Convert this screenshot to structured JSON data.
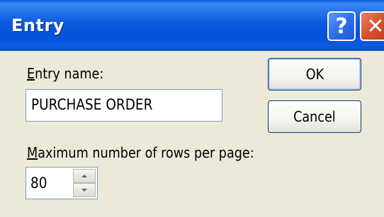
{
  "window": {
    "title": "Entry",
    "help_glyph": "?",
    "close_glyph": "✕"
  },
  "form": {
    "entry_name_label_accel": "E",
    "entry_name_label_rest": "ntry name:",
    "entry_name_value": "PURCHASE ORDER",
    "max_rows_label_accel": "M",
    "max_rows_label_rest": "aximum number of rows per page:",
    "max_rows_value": "80"
  },
  "buttons": {
    "ok_label": "OK",
    "cancel_label": "Cancel"
  },
  "icons": {
    "help": "help-icon",
    "close": "close-icon",
    "spin_up": "chevron-up-icon",
    "spin_down": "chevron-down-icon"
  },
  "colors": {
    "titlebar": "#0b5adc",
    "dialog_background": "#ece9d8",
    "close_button": "#d6502e",
    "help_button": "#2e6ff0"
  }
}
